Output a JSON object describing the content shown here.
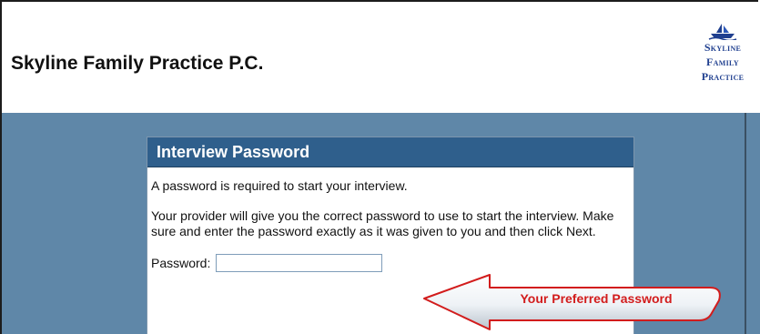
{
  "header": {
    "title": "Skyline Family Practice P.C.",
    "logo": {
      "emblem": "ship-icon",
      "lines": [
        "Skyline",
        "Family",
        "Practice"
      ]
    }
  },
  "panel": {
    "title": "Interview Password",
    "intro": "A password is required to start your interview.",
    "instructions": "Your provider will give you the correct password to use to start the interview. Make sure and enter the password exactly as it was given to you and then click Next.",
    "password_label": "Password:",
    "password_value": ""
  },
  "callout": {
    "text": "Your Preferred Password",
    "color": "#d21c1c"
  },
  "colors": {
    "background": "#5f87a8",
    "panel_header": "#2f5f8c",
    "logo": "#1f3f8f"
  }
}
